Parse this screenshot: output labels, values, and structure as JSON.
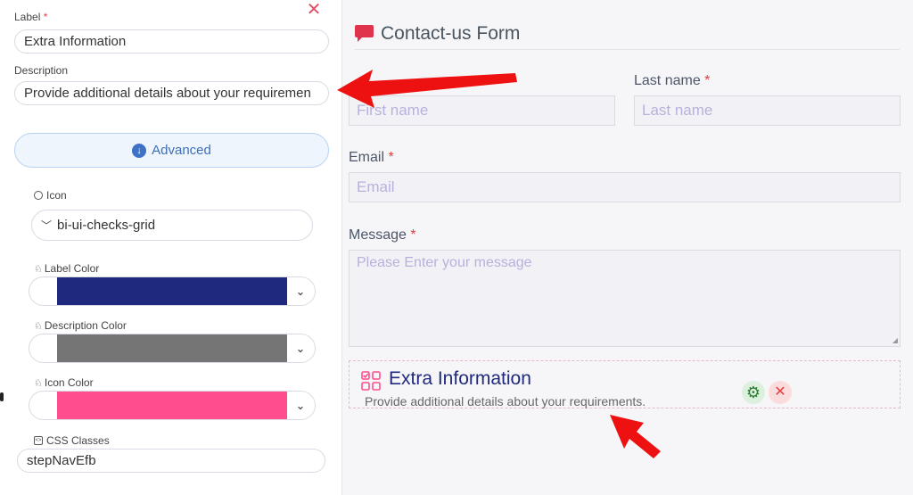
{
  "settings_panel": {
    "label": {
      "text": "Label",
      "required_mark": "*",
      "value": "Extra Information"
    },
    "description": {
      "text": "Description",
      "value": "Provide additional details about your requiremen"
    },
    "advanced_button": {
      "label": "Advanced"
    },
    "icon": {
      "label": "Icon",
      "selected": "bi-ui-checks-grid"
    },
    "label_color": {
      "label": "Label Color",
      "value": "#1f2a7e"
    },
    "description_color": {
      "label": "Description Color",
      "value": "#757575"
    },
    "icon_color": {
      "label": "Icon Color",
      "value": "#ff4d8d"
    },
    "css_classes": {
      "label": "CSS Classes",
      "value": "stepNavEfb"
    }
  },
  "form": {
    "title": "Contact-us Form",
    "accent_color": "#e0334c",
    "fields": {
      "first_name": {
        "placeholder": "First name"
      },
      "last_name": {
        "label": "Last name",
        "required_mark": "*",
        "placeholder": "Last name"
      },
      "email": {
        "label": "Email",
        "required_mark": "*",
        "placeholder": "Email"
      },
      "message": {
        "label": "Message",
        "required_mark": "*",
        "placeholder": "Please Enter your message"
      }
    },
    "extra_block": {
      "title": "Extra Information",
      "description": "Provide additional details about your requirements."
    }
  },
  "annotations": {
    "arrow_color": "#ee1111"
  }
}
